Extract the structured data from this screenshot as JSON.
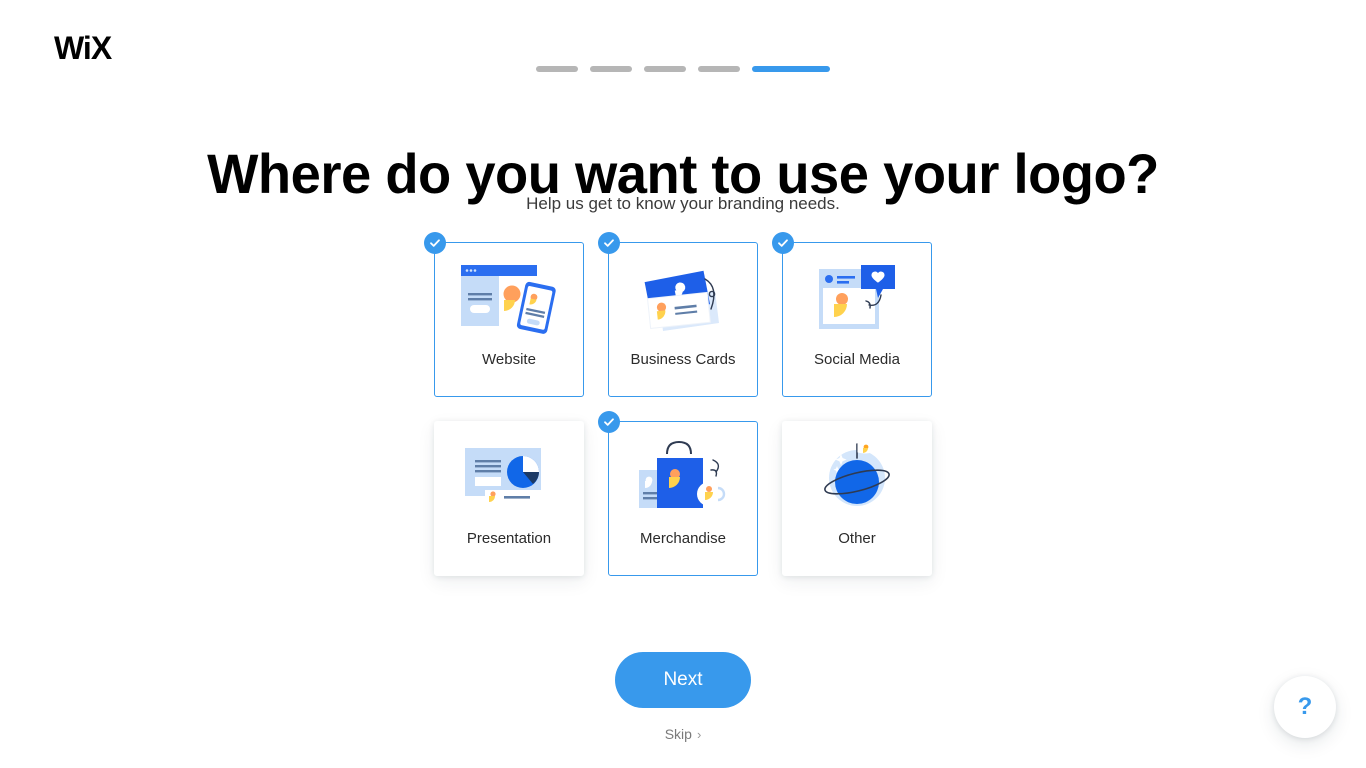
{
  "brand": {
    "name": "WiX",
    "logo_icon": "wix-logo"
  },
  "progress": {
    "total_steps": 5,
    "current_step": 5,
    "segments": [
      "done",
      "done",
      "done",
      "done",
      "active"
    ],
    "active_color": "#3899ec",
    "inactive_color": "#b6b6b6"
  },
  "header": {
    "title": "Where do you want to use your logo?",
    "subtitle": "Help us get to know your branding needs."
  },
  "options": [
    {
      "label": "Website",
      "icon": "website-illustration",
      "selected": true,
      "check_icon": "check-icon"
    },
    {
      "label": "Business Cards",
      "icon": "business-cards-illustration",
      "selected": true,
      "check_icon": "check-icon"
    },
    {
      "label": "Social Media",
      "icon": "social-media-illustration",
      "selected": true,
      "check_icon": "check-icon"
    },
    {
      "label": "Presentation",
      "icon": "presentation-illustration",
      "selected": false,
      "check_icon": ""
    },
    {
      "label": "Merchandise",
      "icon": "merchandise-illustration",
      "selected": true,
      "check_icon": "check-icon"
    },
    {
      "label": "Other",
      "icon": "other-planet-illustration",
      "selected": false,
      "check_icon": ""
    }
  ],
  "footer": {
    "next_label": "Next",
    "skip_label": "Skip",
    "skip_chevron": "›",
    "help_label": "?"
  },
  "colors": {
    "accent_blue": "#3899ec",
    "illustration_blue": "#1e5fe8",
    "illustration_light_blue": "#c5dcf8",
    "illustration_yellow": "#ffd24d",
    "illustration_orange": "#ffa05c",
    "text_dark": "#2b2b2b"
  }
}
